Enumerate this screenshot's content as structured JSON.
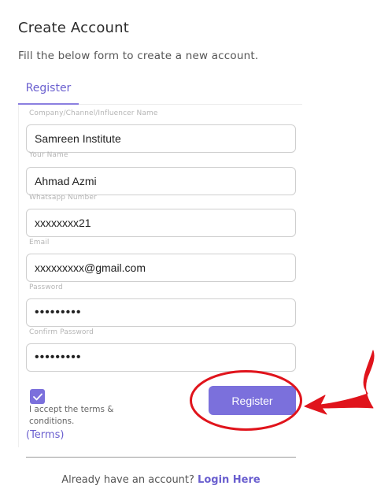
{
  "header": {
    "title": "Create Account",
    "subtitle": "Fill the below form to create a new account."
  },
  "tabs": [
    {
      "label": "Register",
      "active": true
    }
  ],
  "form": {
    "fields": [
      {
        "label": "Company/Channel/Influencer Name",
        "value": "Samreen Institute",
        "type": "text"
      },
      {
        "label": "Your Name",
        "value": "Ahmad Azmi",
        "type": "text"
      },
      {
        "label": "Whatsapp Number",
        "value": "xxxxxxxx21",
        "type": "text"
      },
      {
        "label": "Email",
        "value": "xxxxxxxxx@gmail.com",
        "type": "email"
      },
      {
        "label": "Password",
        "value": "•••••••••",
        "type": "password"
      },
      {
        "label": "Confirm Password",
        "value": "•••••••••",
        "type": "password"
      }
    ],
    "terms_checked": true,
    "terms_text": "I accept the terms & conditions.",
    "terms_link": "(Terms)",
    "submit_label": "Register"
  },
  "footer": {
    "prompt": "Already have an account?",
    "login_link": "Login Here"
  },
  "colors": {
    "accent": "#7b70dc",
    "annotation": "#e0141c"
  },
  "icons": {
    "checkbox": "checkmark-icon"
  }
}
